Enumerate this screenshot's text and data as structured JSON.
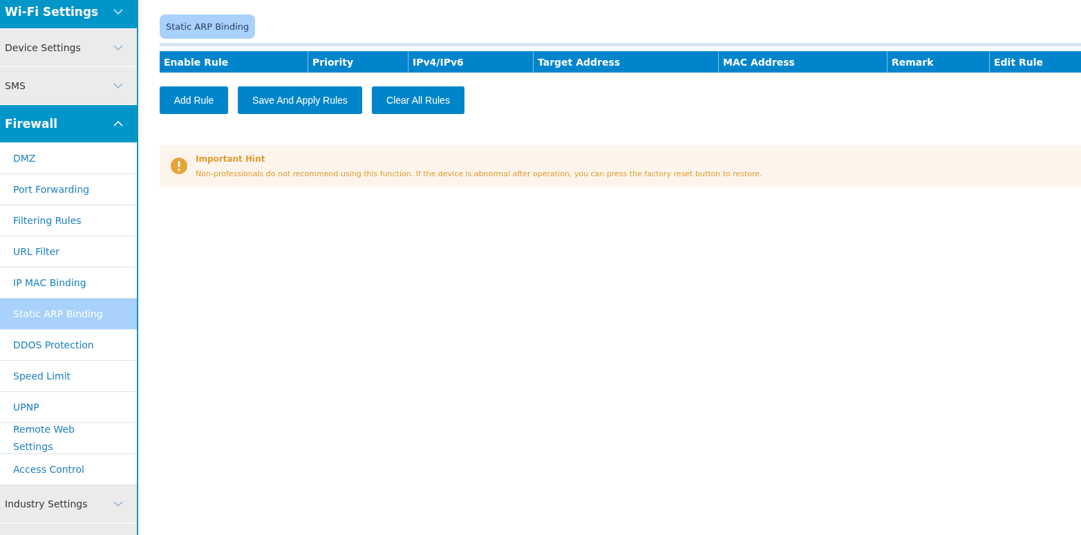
{
  "sidebar": {
    "groups": [
      {
        "label": "Wi-Fi Settings",
        "kind": "primary",
        "expanded": false
      },
      {
        "label": "Device Settings",
        "kind": "secondary",
        "expanded": false
      },
      {
        "label": "SMS",
        "kind": "secondary",
        "expanded": false
      },
      {
        "label": "Firewall",
        "kind": "primary",
        "expanded": true,
        "items": [
          {
            "label": "DMZ",
            "selected": false
          },
          {
            "label": "Port Forwarding",
            "selected": false
          },
          {
            "label": "Filtering Rules",
            "selected": false
          },
          {
            "label": "URL Filter",
            "selected": false
          },
          {
            "label": "IP MAC Binding",
            "selected": false
          },
          {
            "label": "Static ARP Binding",
            "selected": true
          },
          {
            "label": "DDOS Protection",
            "selected": false
          },
          {
            "label": "Speed Limit",
            "selected": false
          },
          {
            "label": "UPNP",
            "selected": false
          },
          {
            "label": "Remote Web Settings",
            "selected": false
          },
          {
            "label": "Access Control",
            "selected": false
          }
        ]
      },
      {
        "label": "Industry Settings",
        "kind": "secondary",
        "expanded": false
      }
    ]
  },
  "tabs": [
    {
      "label": "Static ARP Binding",
      "selected": true
    }
  ],
  "table": {
    "columns": [
      "Enable Rule",
      "Priority",
      "IPv4/IPv6",
      "Target Address",
      "MAC Address",
      "Remark",
      "Edit Rule"
    ]
  },
  "buttons": [
    "Add Rule",
    "Save And Apply Rules",
    "Clear All Rules"
  ],
  "hint": {
    "title": "Important Hint",
    "text": "Non-professionals do not recommend using this function. If the device is abnormal after operation, you can press the factory reset button to restore."
  }
}
